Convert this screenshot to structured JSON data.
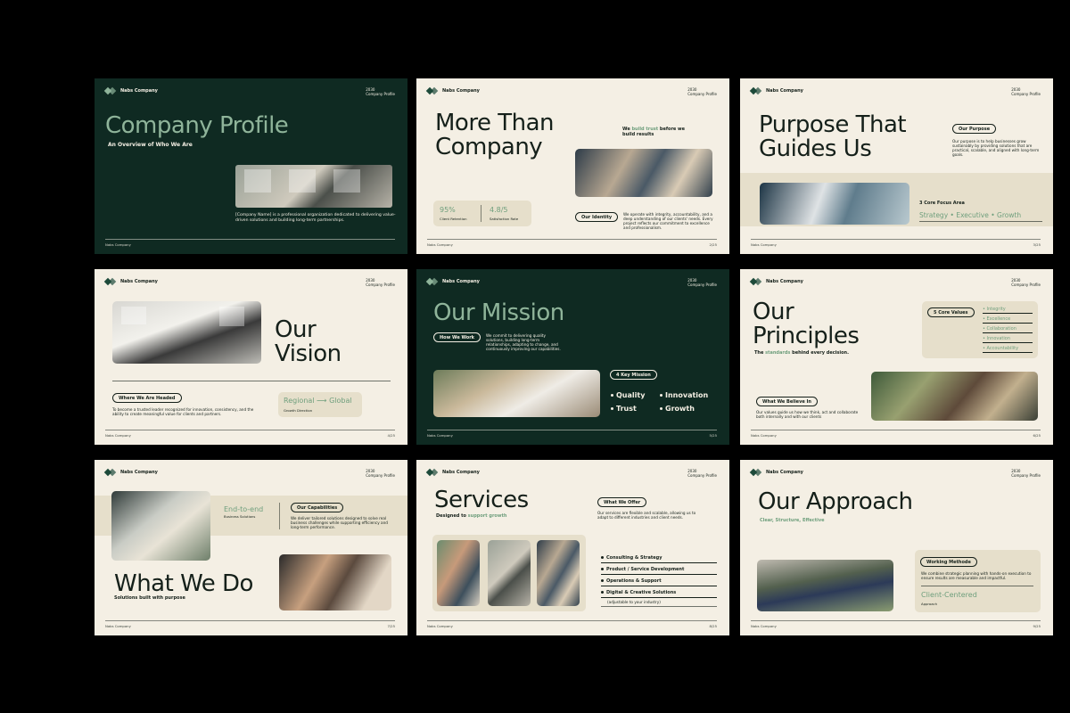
{
  "brand": "Nabs Company",
  "year": "2030",
  "doc": "Company Profile",
  "footer": "Nabs Company",
  "s1": {
    "title": "Company Profile",
    "subtitle": "An Overview of Who We Are",
    "body": "[Company Name] is a professional organization dedicated to delivering value-driven solutions and building long-term partnerships.",
    "footer": "Nabs Company"
  },
  "s2": {
    "title_l1": "More Than",
    "title_l2": "Company",
    "tag_pre": "We ",
    "tag_accent": "build trust",
    "tag_post": " before we build results",
    "stat1_value": "95%",
    "stat1_label": "Client Retention",
    "stat2_value": "4.8/5",
    "stat2_label": "Satisfaction Rate",
    "pill": "Our Identity",
    "body": "We operate with integrity, accountability, and a deep understanding of our clients' needs. Every project reflects our commitment to excellence and professionalism.",
    "page": "2/25"
  },
  "s3": {
    "title_l1": "Purpose That",
    "title_l2": "Guides Us",
    "pill": "Our Purpose",
    "body": "Our purpose is to help businesses grow sustainably by providing solutions that are practical, scalable, and aligned with long-term goals.",
    "focus_label": "3 Core Focus Area",
    "focus_items": "Strategy • Executive • Growth",
    "page": "3/25"
  },
  "s4": {
    "title_l1": "Our",
    "title_l2": "Vision",
    "pill": "Where We Are Headed",
    "body": "To become a trusted leader recognized for innovation, consistency, and the ability to create meaningful value for clients and partners.",
    "direction": "Regional ⟶ Global",
    "direction_label": "Growth Direction",
    "page": "4/25"
  },
  "s5": {
    "title": "Our Mission",
    "pill": "How We Work",
    "body": "We commit to delivering quality solutions, building long-term relationships, adapting to change, and continuously improving our capabilities.",
    "key_pill": "4 Key Mission",
    "items": [
      "Quality",
      "Innovation",
      "Trust",
      "Growth"
    ],
    "page": "5/25"
  },
  "s6": {
    "title_l1": "Our",
    "title_l2": "Principles",
    "sub_pre": "The ",
    "sub_accent": "standards",
    "sub_post": " behind every decision.",
    "values_pill": "5 Core Values",
    "values": [
      "• Integrity",
      "• Excellence",
      "• Collaboration",
      "• Innovation",
      "• Accountability"
    ],
    "pill": "What We Believe In",
    "body": "Our values guide us how we think, act and collaborate both internally and with our clients",
    "page": "6/25"
  },
  "s7": {
    "title": "What We Do",
    "subtitle": "Solutions built with purpose",
    "e2e": "End-to-end",
    "e2e_label": "Business Solutions",
    "pill": "Our Capabilities",
    "body": "We deliver tailored solutions designed to solve real business challenges while supporting efficiency and long-term performance.",
    "page": "7/25"
  },
  "s8": {
    "title": "Services",
    "sub_pre": "Designed to ",
    "sub_accent": "support growth",
    "pill": "What We Offer",
    "body": "Our services are flexible and scalable, allowing us to adapt to different industries and client needs.",
    "items": [
      "Consulting & Strategy",
      "Product / Service Development",
      "Operations & Support",
      "Digital & Creative Solutions"
    ],
    "note": "(adjustable to your industry)",
    "page": "8/25"
  },
  "s9": {
    "title": "Our Approach",
    "subtitle": "Clear, Structure, Effective",
    "pill": "Working Methode",
    "body": "We combine strategic planning with hands-on execution to ensure results are measurable and impactful.",
    "centered": "Client-Centered",
    "centered_label": "Approach",
    "page": "9/25"
  },
  "colors": {
    "dark": "#0f2a22",
    "cream": "#f4efe4",
    "accent": "#8fb49a"
  }
}
